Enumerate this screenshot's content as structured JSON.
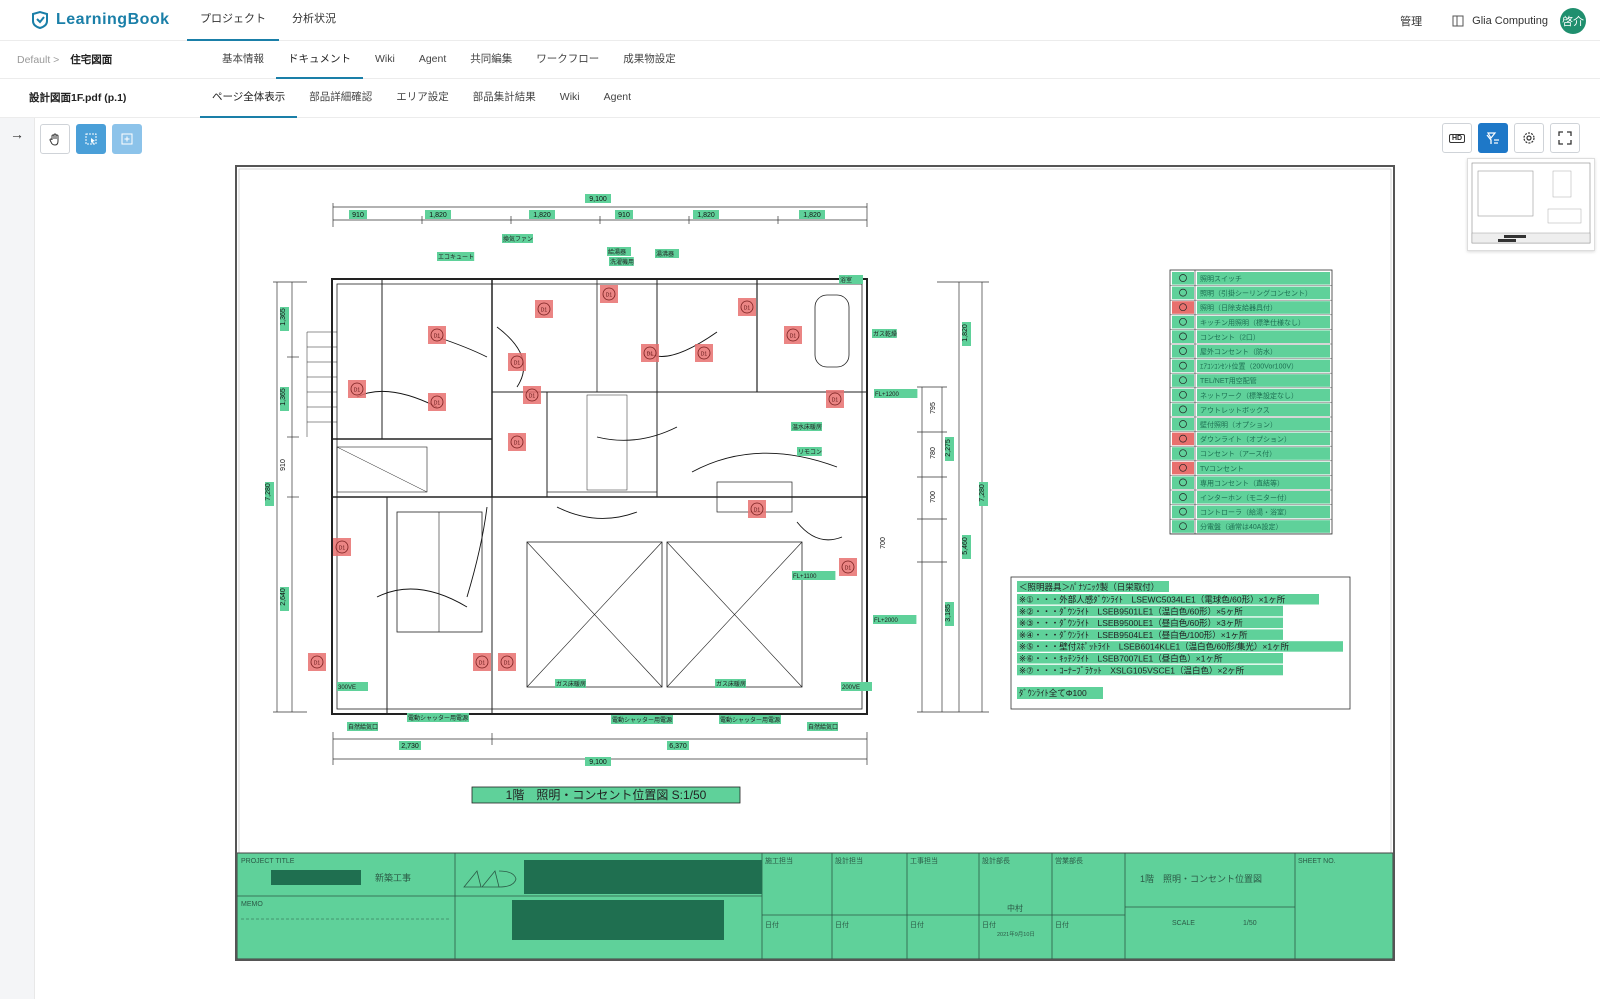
{
  "app": {
    "name": "LearningBook"
  },
  "topnav": {
    "tabs": [
      {
        "label": "プロジェクト"
      },
      {
        "label": "分析状況"
      }
    ]
  },
  "topright": {
    "admin": "管理",
    "org": "Glia Computing",
    "avatar": "啓介"
  },
  "breadcrumb": {
    "root": "Default >",
    "current": "住宅図面"
  },
  "subnav": {
    "tabs": [
      {
        "label": "基本情報"
      },
      {
        "label": "ドキュメント"
      },
      {
        "label": "Wiki"
      },
      {
        "label": "Agent"
      },
      {
        "label": "共同編集"
      },
      {
        "label": "ワークフロー"
      },
      {
        "label": "成果物設定"
      }
    ]
  },
  "doc": {
    "name": "設計図面1F.pdf (p.1)"
  },
  "docnav": {
    "tabs": [
      {
        "label": "ページ全体表示"
      },
      {
        "label": "部品詳細確認"
      },
      {
        "label": "エリア設定"
      },
      {
        "label": "部品集計結果"
      },
      {
        "label": "Wiki"
      },
      {
        "label": "Agent"
      }
    ]
  },
  "toolbar": {
    "hd": "HD"
  },
  "drawing": {
    "dims_top": {
      "total": "9,100",
      "parts": [
        "910",
        "1,820",
        "1,820",
        "910",
        "1,820",
        "1,820"
      ]
    },
    "dims_bottom": {
      "parts": [
        "2,730",
        "6,370"
      ],
      "total": "9,100"
    },
    "dims_left": [
      "1,365",
      "1,365",
      "910",
      "2,640"
    ],
    "dims_left_total": "7,280",
    "dims_right": [
      "1,820",
      "795",
      "780",
      "2,275",
      "700",
      "700",
      "3,185"
    ],
    "dims_right_outer": [
      "7,280",
      "5,460"
    ],
    "room_labels": [
      "換気ファン",
      "エコキュート",
      "給湯器",
      "湯沸器",
      "洗濯機用",
      "浴室",
      "ガス乾燥",
      "FL+1200",
      "FL+2000",
      "FL+1100",
      "ガス床暖房",
      "ガス床暖房",
      "電動シャッター用電源",
      "電動シャッター用電源",
      "電動シャッター用電源",
      "自然給気口",
      "自然給気口",
      "リモコン",
      "温水床暖房",
      "300VE",
      "200VE"
    ],
    "title_text": "1階　照明・コンセント位置図 S:1/50",
    "marker_label": "D1"
  },
  "legend": {
    "items": [
      "照明スイッチ",
      "照明（引掛シーリングコンセント）",
      "照明（日除支給器具付）",
      "キッチン用照明（標準仕様なし）",
      "コンセント（2口）",
      "屋外コンセント（防水）",
      "ｴｱｺﾝｺﾝｾﾝﾄ位置（200Vor100V）",
      "TEL/NET用空配管",
      "ネットワーク（標準設定なし）",
      "アウトレットボックス",
      "壁付照明（オプション）",
      "ダウンライト（オプション）",
      "コンセント（アース付）",
      "TVコンセント",
      "専用コンセント（直結等）",
      "インターホン（モニター付）",
      "コントローラ（給湯・浴室）",
      "分電盤（通常は40A設定）"
    ]
  },
  "notes": {
    "header": "＜照明器具＞ﾊﾟﾅｿﾆｯｸ製（日栄取付）",
    "lines": [
      "※①・・・外部人感ﾀﾞｳﾝﾗｲﾄ　LSEWC5034LE1（電球色/60形）×1ヶ所",
      "※②・・・ﾀﾞｳﾝﾗｲﾄ　LSEB9501LE1（温白色/60形）×5ヶ所",
      "※③・・・ﾀﾞｳﾝﾗｲﾄ　LSEB9500LE1（昼白色/60形）×3ヶ所",
      "※④・・・ﾀﾞｳﾝﾗｲﾄ　LSEB9504LE1（昼白色/100形）×1ヶ所",
      "※⑤・・・壁付ｽﾎﾟｯﾄﾗｲﾄ　LSEB6014KLE1（温白色/60形/集光）×1ヶ所",
      "※⑥・・・ｷｯﾁﾝﾗｲﾄ　LSEB7007LE1（昼白色）×1ヶ所",
      "※⑦・・・ｺｰﾅｰﾌﾞﾗｹｯﾄ　XSLG105VSCE1（温白色）×2ヶ所"
    ],
    "footer": "ﾀﾞｳﾝﾗｲﾄ全てΦ100"
  },
  "titleblock": {
    "project_title_label": "PROJECT TITLE",
    "project_title": "新築工事",
    "memo_label": "MEMO",
    "cells": [
      "施工担当",
      "設計担当",
      "工事担当",
      "設計部長",
      "営業部長"
    ],
    "date_label": "日付",
    "middle": "中村",
    "date_value": "2021年9月10日",
    "sheet_title": "1階　照明・コンセント位置図",
    "scale_label": "SCALE",
    "scale": "1/50",
    "sheet_no_label": "SHEET NO."
  },
  "colors": {
    "accent": "#1a7fa8",
    "highlight_green": "#5fd19a",
    "highlight_red": "#e8706e",
    "title_block_dark": "#1f6f50"
  }
}
